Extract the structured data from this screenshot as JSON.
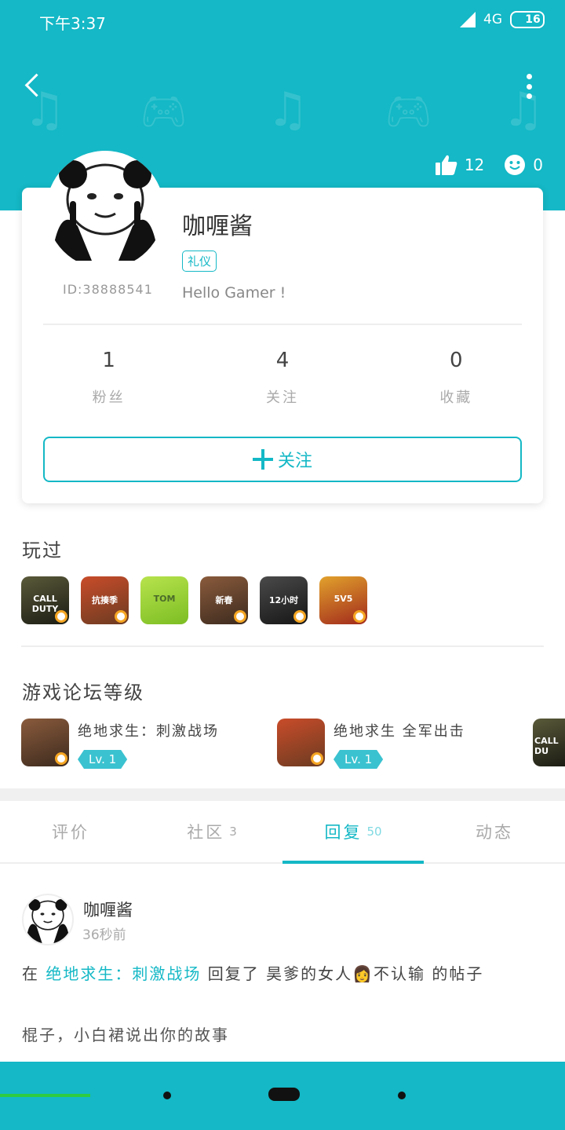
{
  "status_bar": {
    "time": "下午3:37",
    "network": "4G",
    "battery": "16"
  },
  "profile": {
    "likes": "12",
    "smiles": "0",
    "name": "咖喱酱",
    "tag": "礼仪",
    "id": "ID:38888541",
    "bio": "Hello Gamer !"
  },
  "counts": [
    {
      "value": "1",
      "label": "粉丝"
    },
    {
      "value": "4",
      "label": "关注"
    },
    {
      "value": "0",
      "label": "收藏"
    }
  ],
  "follow_button": "关注",
  "played": {
    "title": "玩过",
    "games": [
      "CALL DUTY",
      "抗揍季",
      "TOM",
      "新春",
      "12小时",
      "5V5"
    ]
  },
  "forum": {
    "title": "游戏论坛等级",
    "items": [
      {
        "name": "绝地求生：刺激战场",
        "level": "Lv. 1"
      },
      {
        "name": "绝地求生 全军出击",
        "level": "Lv. 1"
      }
    ],
    "partial_icon": "CALL DU"
  },
  "tabs": [
    {
      "label": "评价",
      "count": ""
    },
    {
      "label": "社区",
      "count": "3"
    },
    {
      "label": "回复",
      "count": "50"
    },
    {
      "label": "动态",
      "count": ""
    }
  ],
  "post": {
    "author": "咖喱酱",
    "time": "36秒前",
    "prefix": "在",
    "forum_link": "绝地求生：刺激战场",
    "action": "回复了 昊爹的女人",
    "emoji": "👩",
    "suffix": "不认输 的帖子",
    "body": "棍子，小白裙说出你的故事"
  },
  "colors": {
    "accent": "#14b8c6",
    "nav_active_line": "#2ecc40"
  }
}
